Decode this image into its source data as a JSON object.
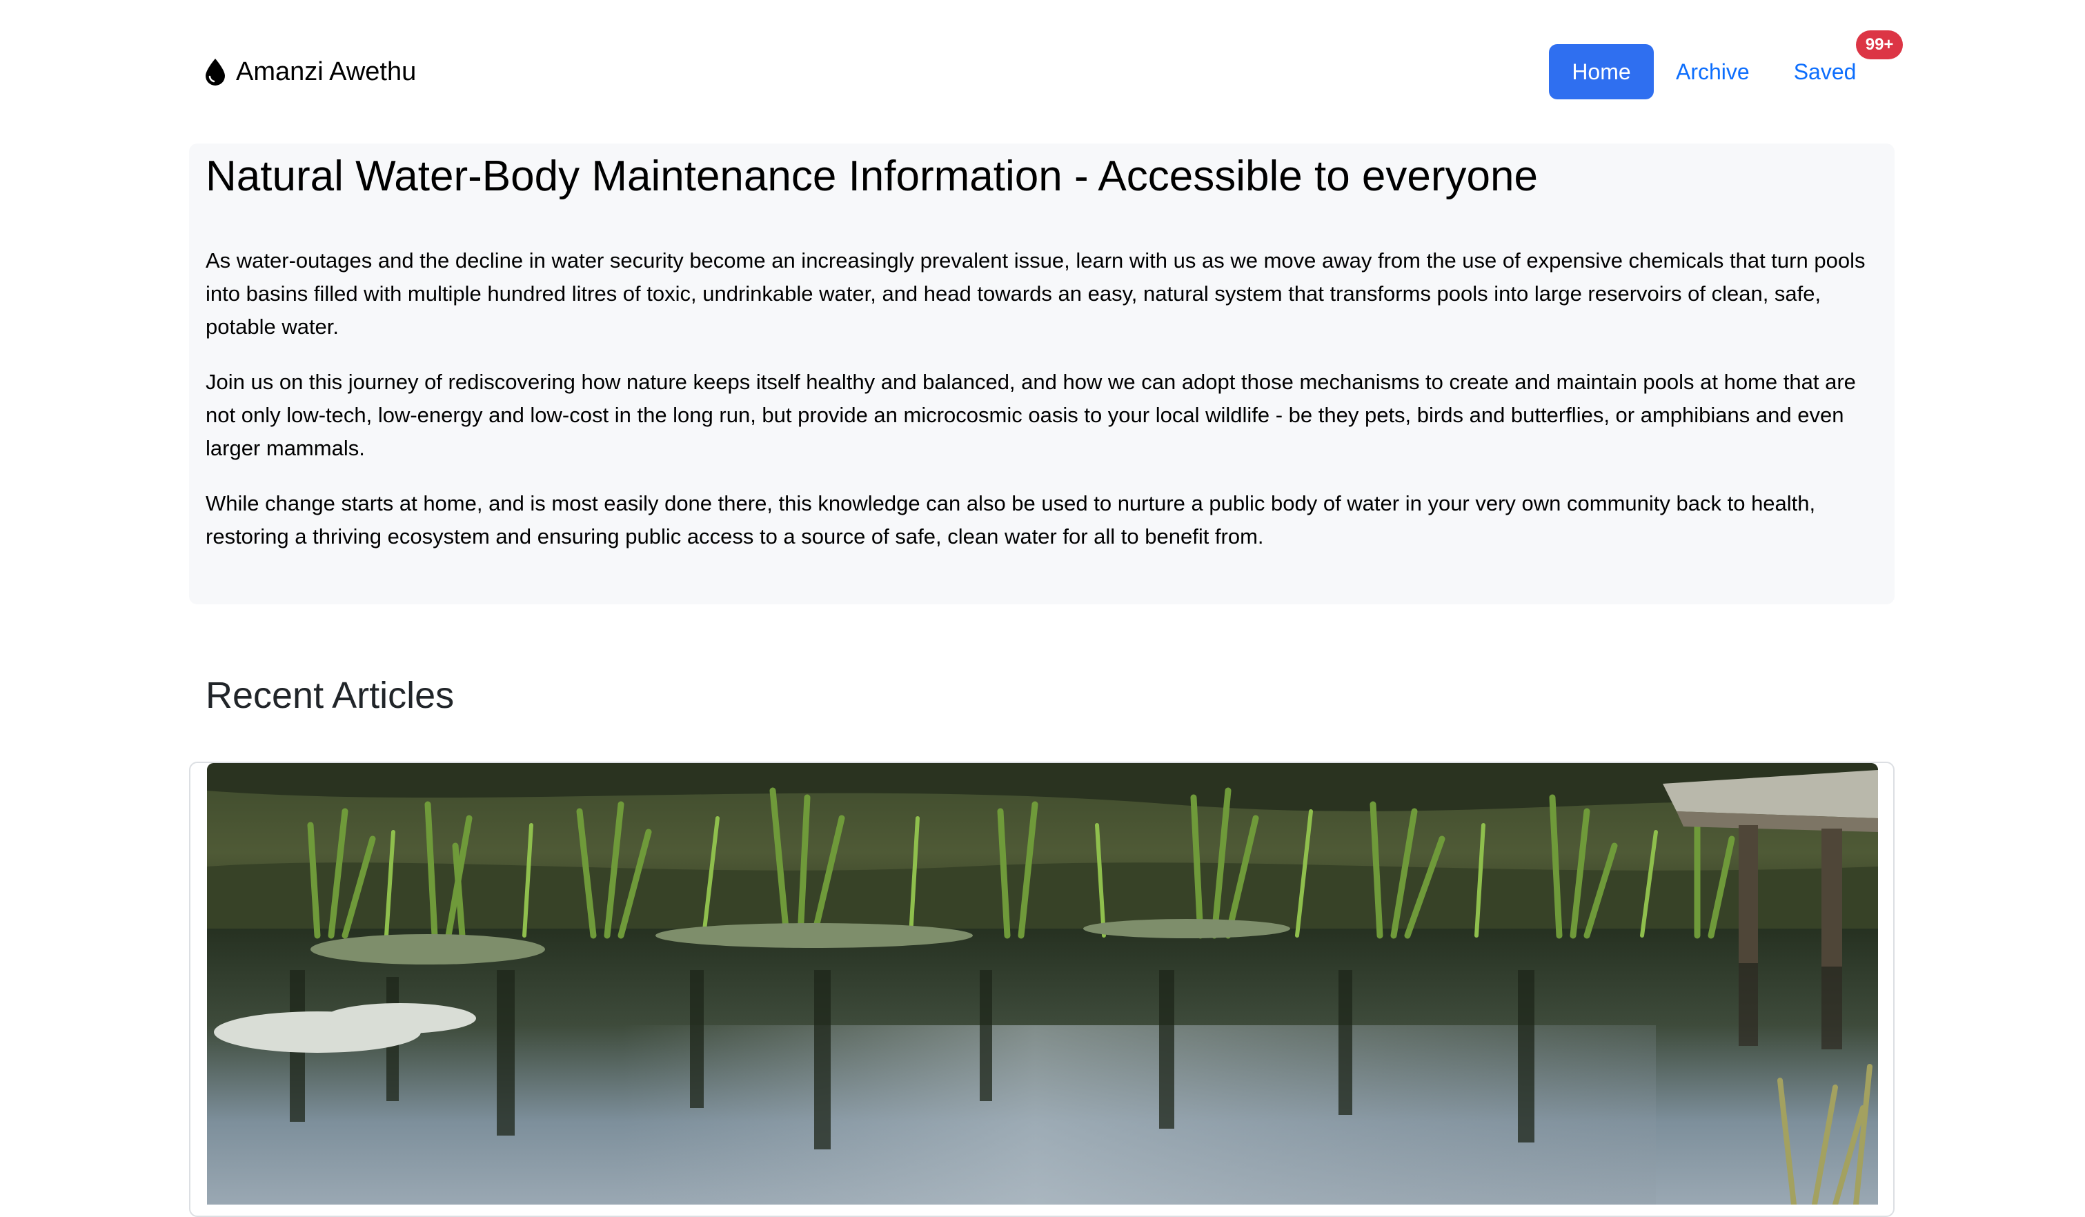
{
  "nav": {
    "brand_icon": "water-drop-icon",
    "brand_text": "Amanzi Awethu",
    "links": [
      {
        "label": "Home",
        "active": true
      },
      {
        "label": "Archive",
        "active": false
      },
      {
        "label": "Saved",
        "active": false,
        "badge": "99+"
      }
    ],
    "accent_color": "#2f6ff0",
    "badge_color": "#dc3545"
  },
  "hero": {
    "title": "Natural Water-Body Maintenance Information - Accessible to everyone",
    "paragraphs": [
      "As water-outages and the decline in water security become an increasingly prevalent issue, learn with us as we move away from the use of expensive chemicals that turn pools into basins filled with multiple hundred litres of toxic, undrinkable water, and head towards an easy, natural system that transforms pools into large reservoirs of clean, safe, potable water.",
      "Join us on this journey of rediscovering how nature keeps itself healthy and balanced, and how we can adopt those mechanisms to create and maintain pools at home that are not only low-tech, low-energy and low-cost in the long run, but provide an microcosmic oasis to your local wildlife - be they pets, birds and butterflies, or amphibians and even larger mammals.",
      "While change starts at home, and is most easily done there, this knowledge can also be used to nurture a public body of water in your very own community back to health, restoring a thriving ecosystem and ensuring public access to a source of safe, clean water for all to benefit from."
    ]
  },
  "recent": {
    "heading": "Recent Articles"
  }
}
